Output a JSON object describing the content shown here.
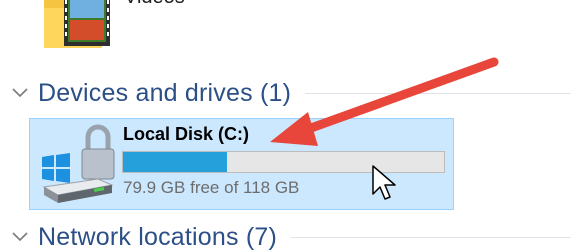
{
  "quick_access": {
    "videos_label": "Videos"
  },
  "devices_group": {
    "title": "Devices and drives (1)"
  },
  "drive": {
    "name": "Local Disk (C:)",
    "free_text": "79.9 GB free of 118 GB",
    "used_fraction": 0.323,
    "icon": "windows-hard-drive-lock-icon"
  },
  "network_group": {
    "title": "Network locations (7)"
  },
  "annotation": {
    "color": "#e8463a",
    "icon": "red-arrow-annotation"
  },
  "colors": {
    "group_title": "#2b4f86",
    "selected_tile_bg": "#cce8ff",
    "selected_tile_border": "#99d1ff",
    "usage_bar_fill": "#26a0da"
  }
}
